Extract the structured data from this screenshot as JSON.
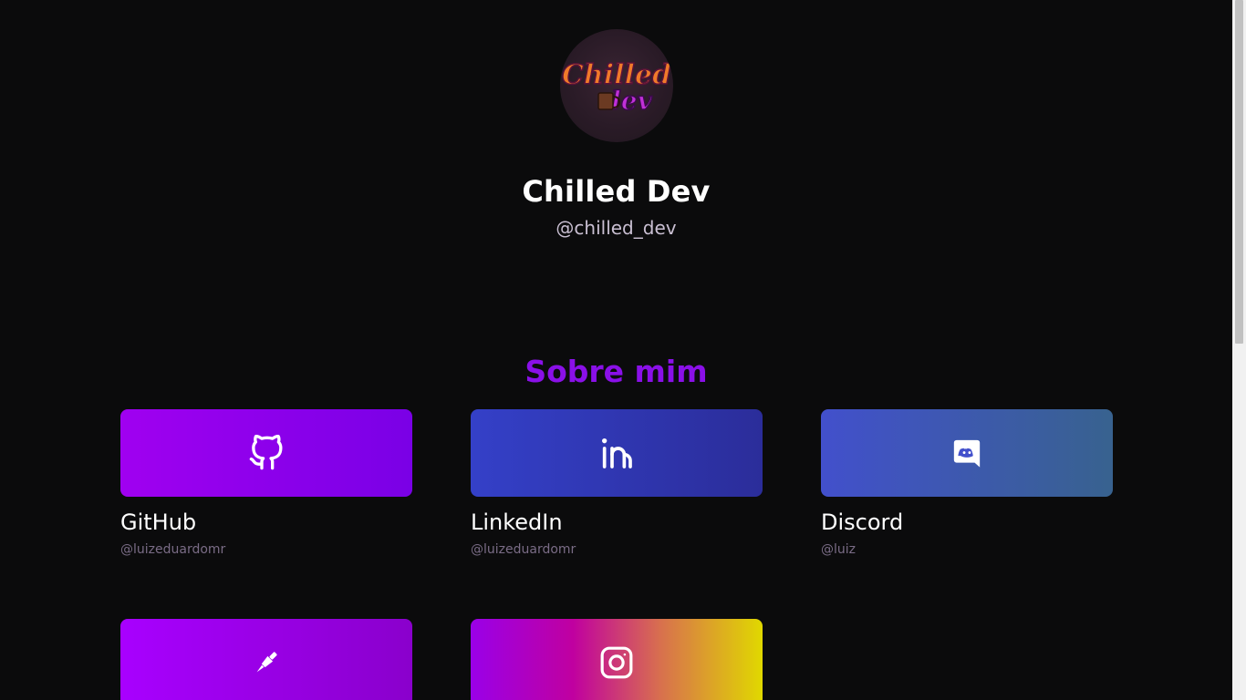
{
  "profile": {
    "logo_text": "Chilled dev",
    "name": "Chilled Dev",
    "handle": "@chilled_dev"
  },
  "section": {
    "title": "Sobre mim"
  },
  "cards": [
    {
      "title": "GitHub",
      "handle": "@luizeduardomr",
      "icon": "github-icon"
    },
    {
      "title": "LinkedIn",
      "handle": "@luizeduardomr",
      "icon": "linkedin-icon"
    },
    {
      "title": "Discord",
      "handle": "@luiz",
      "icon": "discord-icon"
    },
    {
      "title": "",
      "handle": "",
      "icon": "pen-tool-icon"
    },
    {
      "title": "",
      "handle": "",
      "icon": "instagram-icon"
    }
  ],
  "colors": {
    "background": "#0b0b0c",
    "accent": "#8a10e8"
  }
}
